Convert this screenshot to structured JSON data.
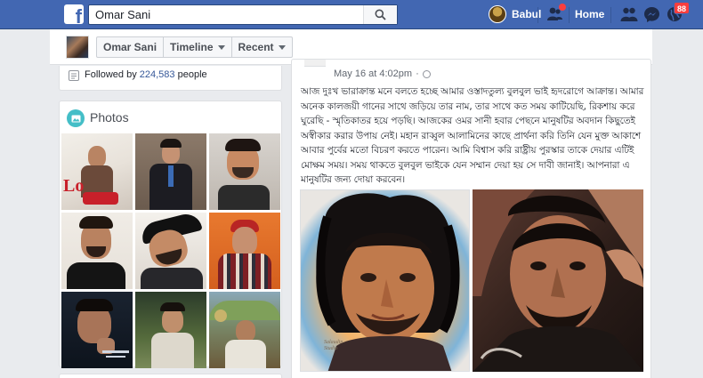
{
  "topbar": {
    "search_value": "Omar Sani",
    "user_name": "Babul",
    "home_label": "Home",
    "notifications_count": "88",
    "brand_color": "#4267b2"
  },
  "subnav": {
    "tabs": [
      {
        "label": "Omar Sani"
      },
      {
        "label": "Timeline"
      },
      {
        "label": "Recent"
      }
    ]
  },
  "intro": {
    "followed_prefix": "Followed by",
    "followed_count": "224,583",
    "followed_suffix": "people"
  },
  "photos": {
    "title": "Photos",
    "icons": [
      "photo-icon"
    ]
  },
  "post": {
    "timestamp": "May 16 at 4:02pm",
    "separator": "·",
    "text": "আজ দুঃখ ভারাক্রান্ত মনে বলতে হচ্ছে আমার ওস্তাদতুল্য বুলবুল ভাই হৃদরোগে আক্রান্ত। আমার অনেক কালজয়ী গানের সাথে জড়িয়ে তার নাম, তার সাথে কত সময় কাটিয়েছি, রিকশায় করে ঘুরেছি - স্মৃতিকাতর হয়ে পড়ছি। আজকের ওমর সানী হবার পেছনে মানুষটির অবদান কিছুতেই অস্বীকার করার উপায় নেই। মহান রাব্বুল আলামিনের কাছে প্রার্থনা করি তিনি যেন মুক্ত আকাশে আবার পুর্বের মতো বিচরণ করতে পারেন। আমি বিশ্বাস করি রাষ্ট্রীয় পুরস্কার তাকে দেয়ার এটিই মোক্ষম সময়। সময় থাকতে বুলবুল ভাইকে যেন সম্মান দেয়া হয় সে দাবী জানাই। আপনারা এ মানুষটির জন্য দোয়া করবেন।"
  }
}
